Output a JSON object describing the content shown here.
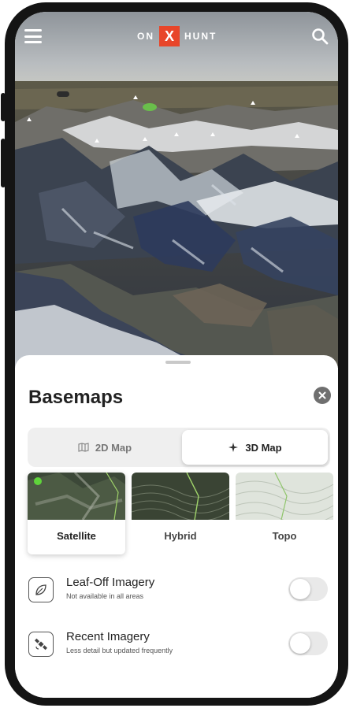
{
  "header": {
    "logo_left": "ON",
    "logo_mark": "X",
    "logo_right": "HUNT",
    "menu_icon": "hamburger-menu-icon",
    "search_icon": "search-icon"
  },
  "sheet": {
    "title": "Basemaps",
    "close_icon": "close-icon"
  },
  "view_toggle": {
    "options": [
      {
        "label": "2D Map",
        "icon": "map-icon",
        "selected": false
      },
      {
        "label": "3D Map",
        "icon": "3d-compass-icon",
        "selected": true
      }
    ]
  },
  "basemaps": [
    {
      "label": "Satellite",
      "selected": true
    },
    {
      "label": "Hybrid",
      "selected": false
    },
    {
      "label": "Topo",
      "selected": false
    }
  ],
  "layers": [
    {
      "title": "Leaf-Off Imagery",
      "subtitle": "Not available in all areas",
      "icon": "leaf-icon",
      "enabled": false
    },
    {
      "title": "Recent Imagery",
      "subtitle": "Less detail but updated frequently",
      "icon": "satellite-icon",
      "enabled": false
    }
  ],
  "colors": {
    "brand_accent": "#e8462a",
    "selected_dot": "#5fd43b",
    "toggle_off": "#e9e9e9"
  }
}
